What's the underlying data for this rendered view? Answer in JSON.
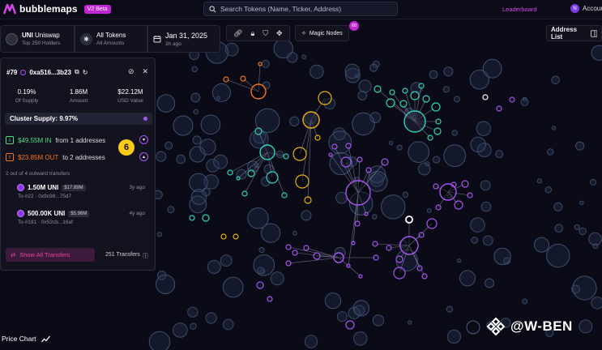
{
  "app": {
    "name": "bubblemaps",
    "badge": "V2 Beta",
    "search_placeholder": "Search Tokens (Name, Ticker, Address)",
    "leaderboard": "Leaderboard",
    "account_initial": "N",
    "account_label": "Account"
  },
  "toolbar": {
    "token_symbol": "UNI",
    "token_name": "Uniswap",
    "token_sub": "Top 250 Holders",
    "tokens_title": "All Tokens",
    "tokens_sub": "All Amounts",
    "date": "Jan 31, 2025",
    "date_sub": "3h ago",
    "magic_label": "Magic Nodes",
    "magic_count": "60",
    "address_list": "Address List"
  },
  "panel": {
    "rank": "#79",
    "address": "0xa516...3b23",
    "stats": [
      {
        "value": "0.19%",
        "label": "Of Supply"
      },
      {
        "value": "1.86M",
        "label": "Amount"
      },
      {
        "value": "$22.12M",
        "label": "USD Value"
      }
    ],
    "cluster_supply": "Cluster Supply: 9.97%",
    "in_amount": "$49.55M IN",
    "in_rest": "from 1 addresses",
    "out_amount": "$23.85M OUT",
    "out_rest": "to 2 addresses",
    "step_number": "6",
    "summary": "2 out of 4 outward transfers",
    "transfers": [
      {
        "amount": "1.50M UNI",
        "usd": "$17.89M",
        "ago": "3y ago",
        "to": "To #22 · 0x9c98...75d7"
      },
      {
        "amount": "500.00K UNI",
        "usd": "$5.96M",
        "ago": "4y ago",
        "to": "To #181 · 0x52cb...16af"
      }
    ],
    "show_all": "Show All Transfers",
    "transfer_count": "251 Transfers"
  },
  "footer": {
    "price_chart": "Price Chart",
    "watermark": "@W-BEN"
  },
  "colors": {
    "accent": "#c026d3",
    "purple": "#a855f7",
    "teal": "#2dd4bf",
    "yellow": "#eab308",
    "orange": "#f97316",
    "green": "#4ade80",
    "bubble": "#1e293b"
  }
}
